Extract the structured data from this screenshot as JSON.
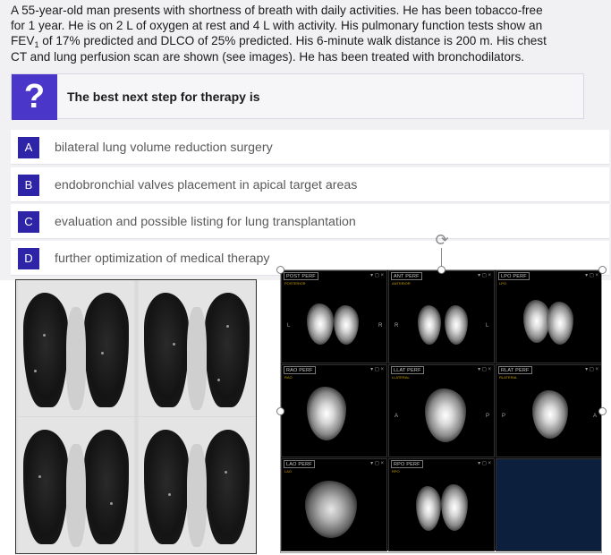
{
  "stem": {
    "line1": "A 55-year-old man presents with shortness of breath with daily activities. He has been tobacco-free",
    "line2": "for 1 year. He is on 2 L of oxygen at rest and 4 L with activity. His pulmonary function tests show an",
    "line3_a": "FEV",
    "line3_sub": "1",
    "line3_b": " of 17% predicted and DLCO of 25% predicted. His 6-minute walk distance is 200 m. His chest",
    "line4": "CT and lung perfusion scan are shown (see images). He has been treated with bronchodilators."
  },
  "question": {
    "icon": "question-mark-icon",
    "icon_glyph": "?",
    "text": "The best next step for therapy is"
  },
  "choices": [
    {
      "letter": "A",
      "text": "bilateral lung volume reduction surgery"
    },
    {
      "letter": "B",
      "text": "endobronchial valves placement in apical target areas"
    },
    {
      "letter": "C",
      "text": "evaluation and possible listing for lung transplantation"
    },
    {
      "letter": "D",
      "text": "further optimization of medical therapy"
    }
  ],
  "perfusion": {
    "panels": [
      {
        "title": "POST PERF",
        "sub": "POSTERIOR"
      },
      {
        "title": "ANT PERF",
        "sub": "ANTERIOR"
      },
      {
        "title": "LPO PERF",
        "sub": "LPO"
      },
      {
        "title": "RAO PERF",
        "sub": "RAO"
      },
      {
        "title": "LLAT PERF",
        "sub": "LLATERAL"
      },
      {
        "title": "RLAT PERF",
        "sub": "RLATERAL"
      },
      {
        "title": "LAO PERF",
        "sub": "LAO"
      },
      {
        "title": "RPO PERF",
        "sub": "RPO"
      }
    ],
    "side_labels": {
      "L": "L",
      "R": "R",
      "A": "A",
      "P": "P"
    },
    "controls_glyph": "▾ ◻ ×"
  },
  "colors": {
    "panel_bg": "#f1f1f4",
    "question_icon_bg": "#4a36c9",
    "choice_letter_bg": "#2d24a8",
    "empty_panel_bg": "#0c1f3c"
  }
}
